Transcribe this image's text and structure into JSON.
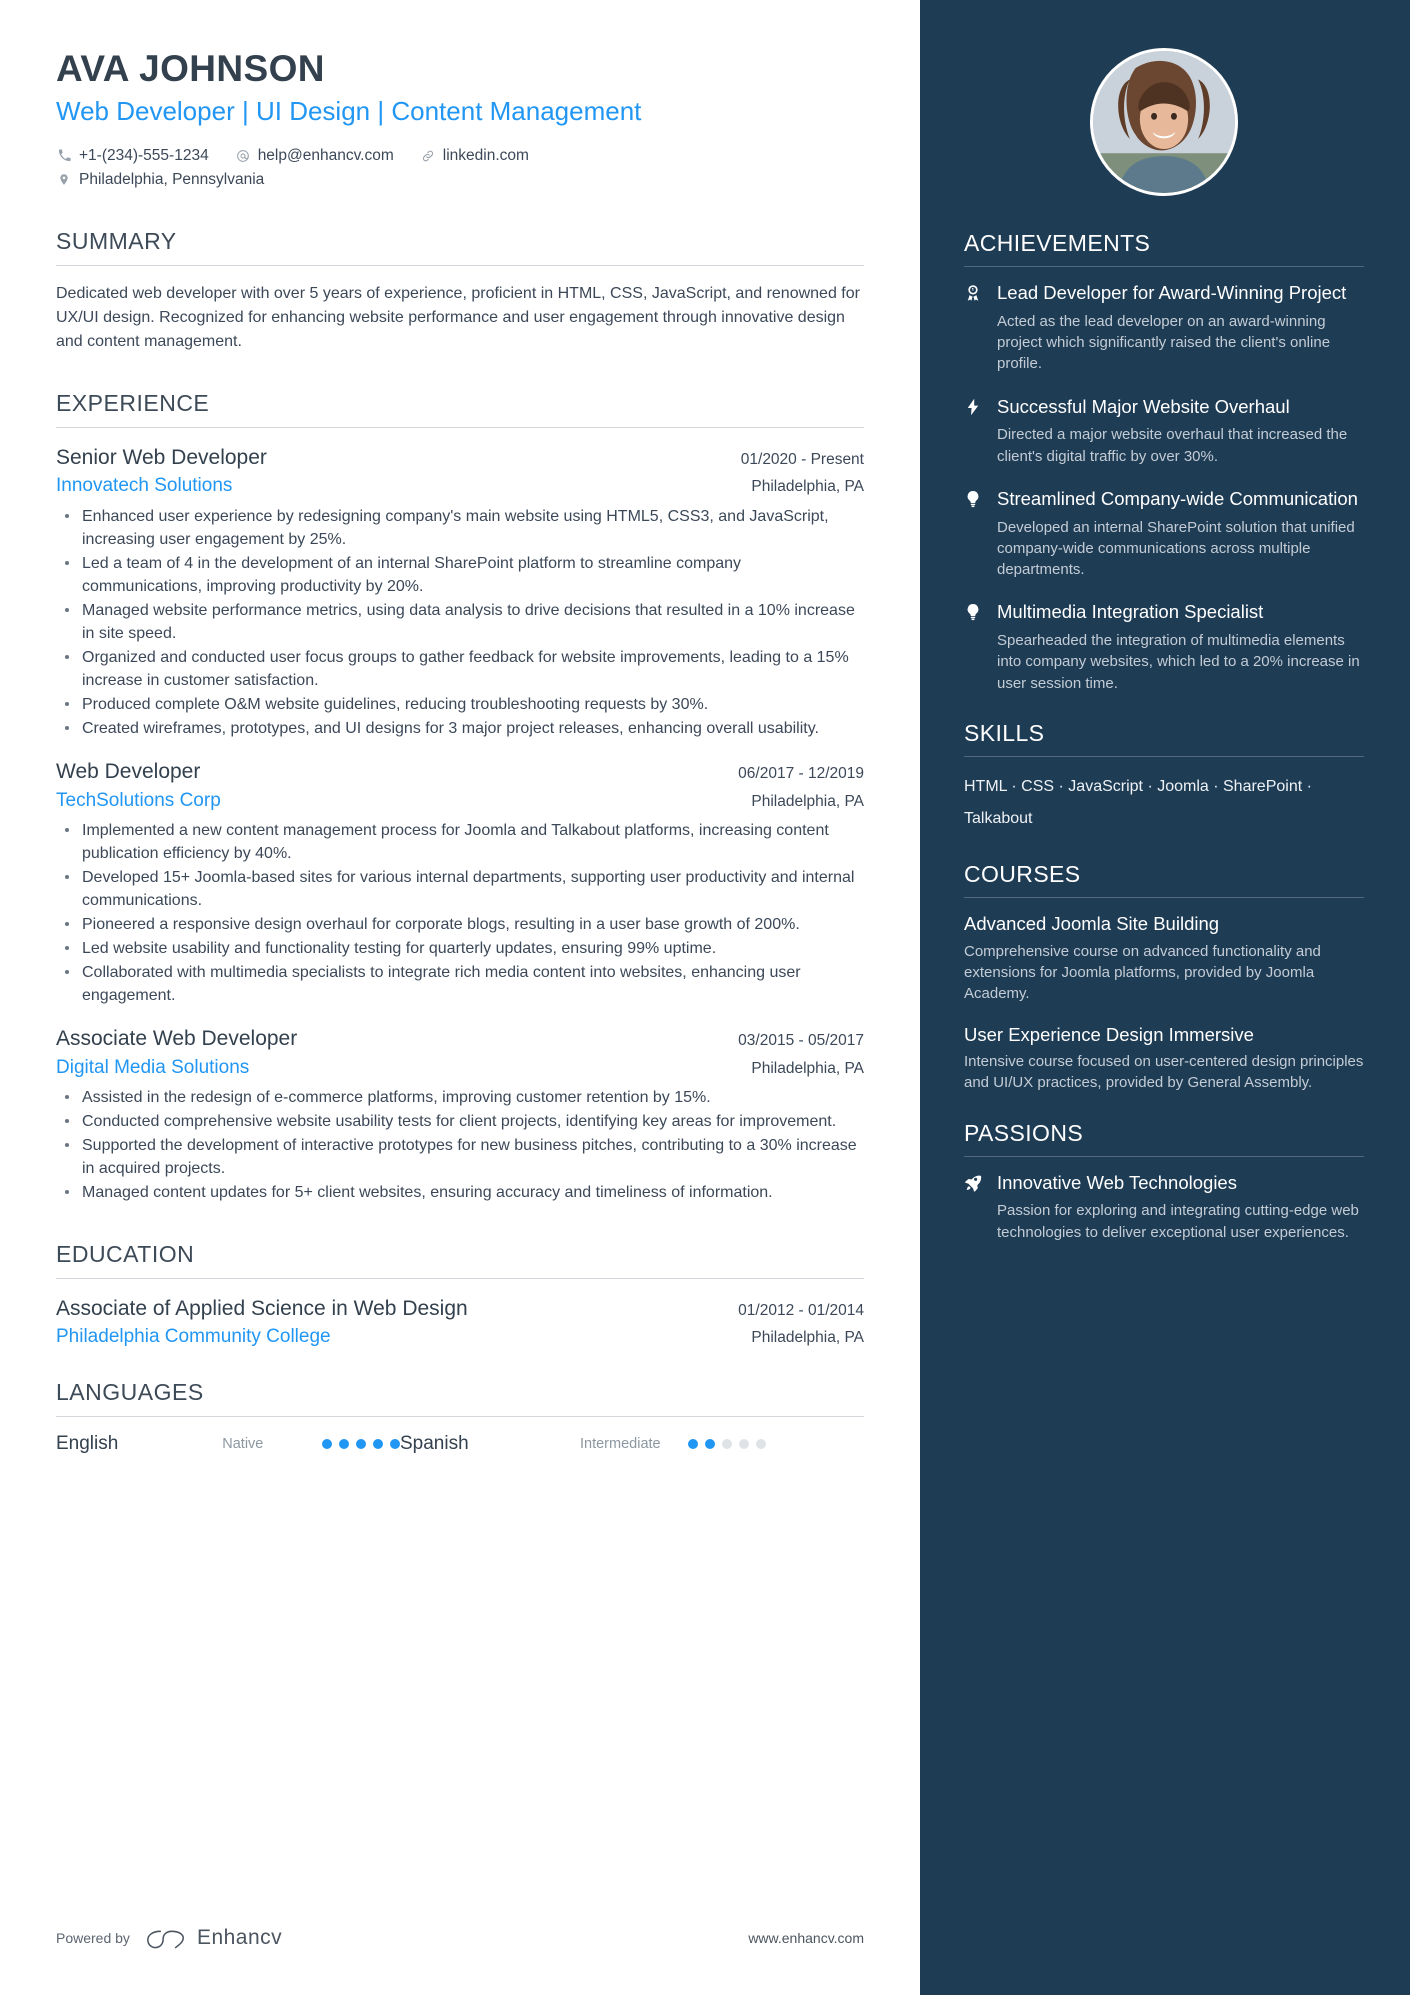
{
  "header": {
    "name": "AVA JOHNSON",
    "headline_parts": [
      "Web Developer",
      "UI Design",
      "Content Management"
    ],
    "separator": "|",
    "contacts": [
      {
        "icon": "phone-icon",
        "text": "+1-(234)-555-1234"
      },
      {
        "icon": "email-icon",
        "text": "help@enhancv.com"
      },
      {
        "icon": "link-icon",
        "text": "linkedin.com"
      }
    ],
    "location": {
      "icon": "location-pin-icon",
      "text": "Philadelphia, Pennsylvania"
    }
  },
  "summary": {
    "title": "SUMMARY",
    "text": "Dedicated web developer with over 5 years of experience, proficient in HTML, CSS, JavaScript, and renowned for UX/UI design. Recognized for enhancing website performance and user engagement through innovative design and content management."
  },
  "experience": {
    "title": "EXPERIENCE",
    "entries": [
      {
        "role": "Senior Web Developer",
        "dates": "01/2020 - Present",
        "company": "Innovatech Solutions",
        "location": "Philadelphia, PA",
        "bullets": [
          "Enhanced user experience by redesigning company's main website using HTML5, CSS3, and JavaScript, increasing user engagement by 25%.",
          "Led a team of 4 in the development of an internal SharePoint platform to streamline company communications, improving productivity by 20%.",
          "Managed website performance metrics, using data analysis to drive decisions that resulted in a 10% increase in site speed.",
          "Organized and conducted user focus groups to gather feedback for website improvements, leading to a 15% increase in customer satisfaction.",
          "Produced complete O&M website guidelines, reducing troubleshooting requests by 30%.",
          "Created wireframes, prototypes, and UI designs for 3 major project releases, enhancing overall usability."
        ]
      },
      {
        "role": "Web Developer",
        "dates": "06/2017 - 12/2019",
        "company": "TechSolutions Corp",
        "location": "Philadelphia, PA",
        "bullets": [
          "Implemented a new content management process for Joomla and Talkabout platforms, increasing content publication efficiency by 40%.",
          "Developed 15+ Joomla-based sites for various internal departments, supporting user productivity and internal communications.",
          "Pioneered a responsive design overhaul for corporate blogs, resulting in a user base growth of 200%.",
          "Led website usability and functionality testing for quarterly updates, ensuring 99% uptime.",
          "Collaborated with multimedia specialists to integrate rich media content into websites, enhancing user engagement."
        ]
      },
      {
        "role": "Associate Web Developer",
        "dates": "03/2015 - 05/2017",
        "company": "Digital Media Solutions",
        "location": "Philadelphia, PA",
        "bullets": [
          "Assisted in the redesign of e-commerce platforms, improving customer retention by 15%.",
          "Conducted comprehensive website usability tests for client projects, identifying key areas for improvement.",
          "Supported the development of interactive prototypes for new business pitches, contributing to a 30% increase in acquired projects.",
          "Managed content updates for 5+ client websites, ensuring accuracy and timeliness of information."
        ]
      }
    ]
  },
  "education": {
    "title": "EDUCATION",
    "entries": [
      {
        "degree": "Associate of Applied Science in Web Design",
        "dates": "01/2012 - 01/2014",
        "school": "Philadelphia Community College",
        "location": "Philadelphia, PA"
      }
    ]
  },
  "languages": {
    "title": "LANGUAGES",
    "items": [
      {
        "name": "English",
        "level": "Native",
        "filled": 5,
        "total": 5
      },
      {
        "name": "Spanish",
        "level": "Intermediate",
        "filled": 2,
        "total": 5
      }
    ]
  },
  "footer": {
    "powered_by": "Powered by",
    "brand": "Enhancv",
    "website": "www.enhancv.com"
  },
  "sidebar": {
    "achievements": {
      "title": "ACHIEVEMENTS",
      "items": [
        {
          "icon": "award-ribbon-icon",
          "title": "Lead Developer for Award-Winning Project",
          "text": "Acted as the lead developer on an award-winning project which significantly raised the client's online profile."
        },
        {
          "icon": "lightning-bolt-icon",
          "title": "Successful Major Website Overhaul",
          "text": "Directed a major website overhaul that increased the client's digital traffic by over 30%."
        },
        {
          "icon": "lightbulb-icon",
          "title": "Streamlined Company-wide Communication",
          "text": "Developed an internal SharePoint solution that unified company-wide communications across multiple departments."
        },
        {
          "icon": "lightbulb-icon",
          "title": "Multimedia Integration Specialist",
          "text": "Spearheaded the integration of multimedia elements into company websites, which led to a 20% increase in user session time."
        }
      ]
    },
    "skills": {
      "title": "SKILLS",
      "text": "HTML · CSS · JavaScript · Joomla · SharePoint · Talkabout"
    },
    "courses": {
      "title": "COURSES",
      "items": [
        {
          "title": "Advanced Joomla Site Building",
          "text": "Comprehensive course on advanced functionality and extensions for Joomla platforms, provided by Joomla Academy."
        },
        {
          "title": "User Experience Design Immersive",
          "text": "Intensive course focused on user-centered design principles and UI/UX practices, provided by General Assembly."
        }
      ]
    },
    "passions": {
      "title": "PASSIONS",
      "items": [
        {
          "icon": "rocket-icon",
          "title": "Innovative Web Technologies",
          "text": "Passion for exploring and integrating cutting-edge web technologies to deliver exceptional user experiences."
        }
      ]
    }
  },
  "colors": {
    "accent_blue": "#2196f3",
    "sidebar_bg": "#1f3c55",
    "text_dark": "#33404d"
  }
}
